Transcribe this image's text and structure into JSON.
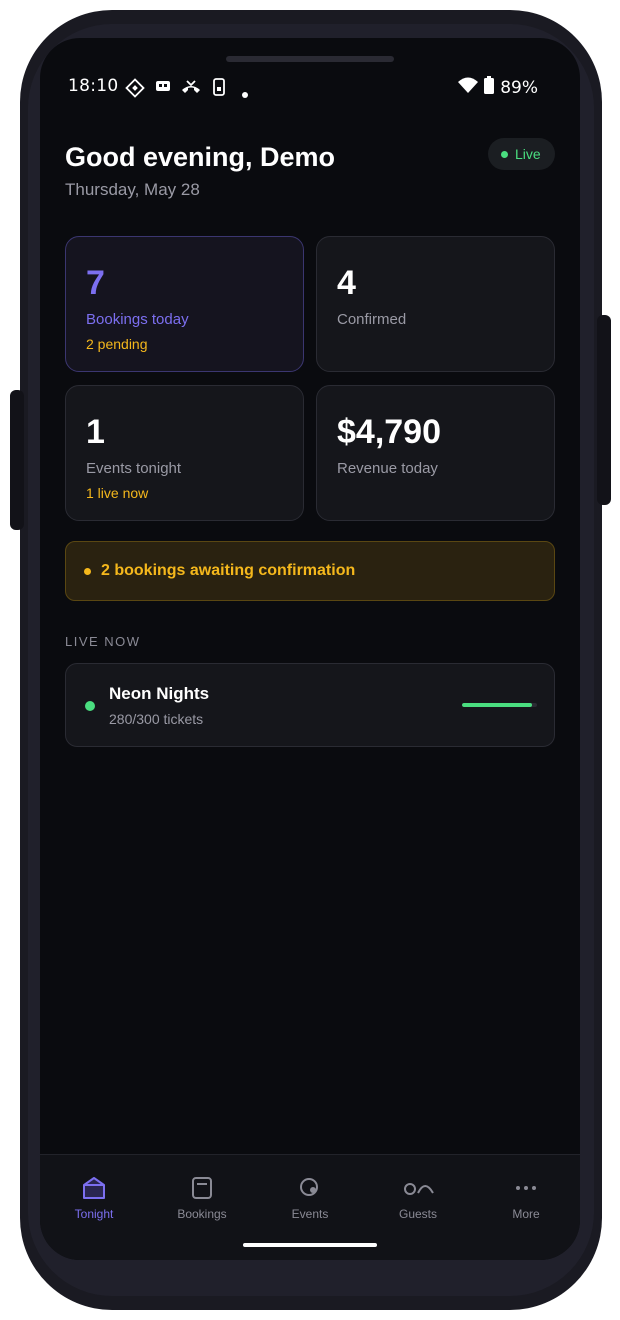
{
  "status_bar": {
    "time": "18:10",
    "battery": "89%"
  },
  "header": {
    "greeting": "Good evening, Demo",
    "date": "Thursday, May 28",
    "live_label": "Live"
  },
  "stats": [
    {
      "value": "7",
      "label": "Bookings today",
      "sub": "2 pending"
    },
    {
      "value": "4",
      "label": "Confirmed",
      "sub": ""
    },
    {
      "value": "1",
      "label": "Events tonight",
      "sub": "1 live now"
    },
    {
      "value": "$4,790",
      "label": "Revenue today",
      "sub": ""
    }
  ],
  "alert": {
    "text": "2 bookings awaiting confirmation"
  },
  "live_now": {
    "section_label": "LIVE NOW",
    "events": [
      {
        "name": "Neon Nights",
        "tickets": "280/300 tickets",
        "progress": 0.93
      }
    ]
  },
  "nav": {
    "items": [
      {
        "label": "Tonight",
        "icon": "home-icon",
        "active": true
      },
      {
        "label": "Bookings",
        "icon": "bookings-icon",
        "active": false
      },
      {
        "label": "Events",
        "icon": "events-icon",
        "active": false
      },
      {
        "label": "Guests",
        "icon": "guests-icon",
        "active": false
      },
      {
        "label": "More",
        "icon": "more-icon",
        "active": false
      }
    ]
  },
  "colors": {
    "accent": "#7c6ff0",
    "live_green": "#4ade80",
    "warning": "#f5b81c",
    "background": "#0a0b0f"
  }
}
